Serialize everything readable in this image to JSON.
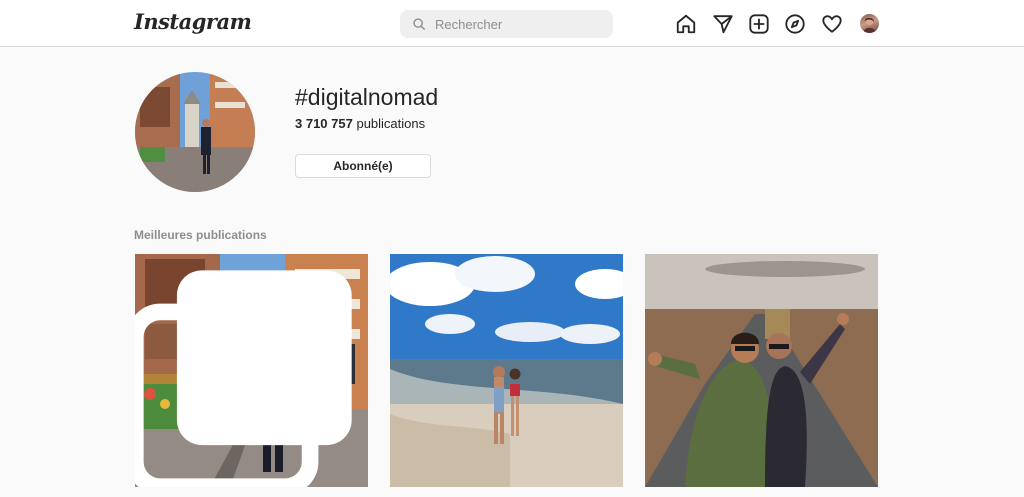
{
  "header": {
    "logo_text": "Instagram",
    "search_placeholder": "Rechercher",
    "icons": [
      "home-icon",
      "direct-message-icon",
      "new-post-icon",
      "explore-icon",
      "activity-heart-icon",
      "profile-avatar"
    ]
  },
  "hashtag": {
    "title": "#digitalnomad",
    "posts_count": "3 710 757",
    "posts_label": "publications",
    "follow_button": "Abonné(e)"
  },
  "top_posts": {
    "section_title": "Meilleures publications",
    "items": [
      {
        "description": "city street tower",
        "multi": true
      },
      {
        "description": "beach couple",
        "multi": false
      },
      {
        "description": "road selfie",
        "multi": false
      }
    ]
  },
  "colors": {
    "background": "#fafafa",
    "border": "#dbdbdb",
    "text": "#262626",
    "muted": "#8e8e8e"
  }
}
